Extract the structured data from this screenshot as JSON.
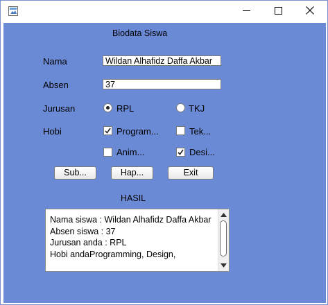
{
  "window": {
    "icon": "java-app-icon",
    "controls": {
      "minimize": "minimize-icon",
      "maximize": "maximize-icon",
      "close": "close-icon"
    }
  },
  "form": {
    "heading": "Biodata Siswa",
    "nama_label": "Nama",
    "nama_value": "Wildan Alhafidz Daffa Akbar",
    "absen_label": "Absen",
    "absen_value": "37",
    "jurusan_label": "Jurusan",
    "jurusan_options": [
      {
        "label": "RPL",
        "selected": true
      },
      {
        "label": "TKJ",
        "selected": false
      }
    ],
    "hobi_label": "Hobi",
    "hobi_options": [
      {
        "label": "Program...",
        "checked": true
      },
      {
        "label": "Tek...",
        "checked": false
      },
      {
        "label": "Anim...",
        "checked": false
      },
      {
        "label": "Desi...",
        "checked": true
      }
    ],
    "buttons": {
      "submit": "Sub...",
      "hapus": "Hap...",
      "exit": "Exit"
    }
  },
  "result": {
    "heading": "HASIL",
    "lines": [
      "Nama siswa :  Wildan Alhafidz Daffa Akbar",
      "Absen siswa : 37",
      "Jurusan anda : RPL",
      "Hobi andaProgramming, Design,"
    ]
  }
}
